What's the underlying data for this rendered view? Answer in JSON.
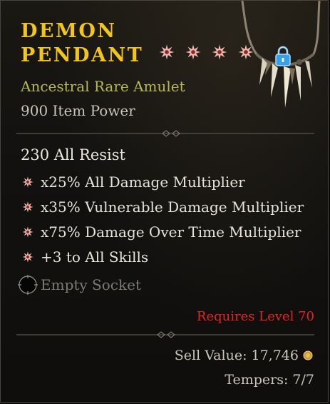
{
  "item": {
    "name_line1": "DEMON",
    "name_line2": "PENDANT",
    "greater_affix_count": 4,
    "type": "Ancestral Rare Amulet",
    "item_power": "900 Item Power"
  },
  "implicit": "230 All Resist",
  "affixes": [
    "x25% All Damage Multiplier",
    "x35% Vulnerable Damage Multiplier",
    "x75% Damage Over Time Multiplier",
    "+3 to All Skills"
  ],
  "socket": "Empty Socket",
  "requirement": "Requires Level 70",
  "sell_value": "Sell Value: 17,746",
  "tempers": "Tempers: 7/7",
  "colors": {
    "name": "#f2c518",
    "rarity": "#b7bb4a",
    "requirement": "#e0261d",
    "gem": "#f0b7b0"
  },
  "icons": {
    "gem": "greater-affix-star-icon",
    "bullet": "affix-bullet-icon",
    "socket": "empty-socket-icon",
    "gold": "gold-coin-icon",
    "lock": "lock-icon",
    "item": "amulet-icon"
  }
}
